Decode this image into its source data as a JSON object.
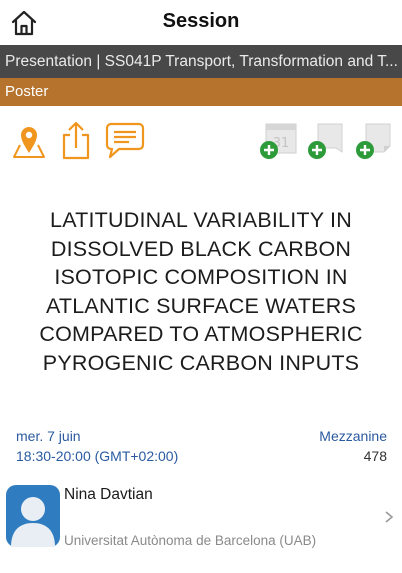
{
  "header": {
    "title": "Session"
  },
  "presentation_bar": {
    "text": "Presentation | SS041P Transport, Transformation and T..."
  },
  "poster_bar": {
    "label": "Poster"
  },
  "toolbar": {
    "left": [
      "map-pin-icon",
      "share-icon",
      "comment-icon"
    ],
    "right": [
      "add-calendar-icon",
      "add-bookmark-icon",
      "add-note-icon"
    ]
  },
  "session": {
    "title": "LATITUDINAL VARIABILITY IN DISSOLVED BLACK CARBON ISOTOPIC COMPOSITION IN ATLANTIC SURFACE WATERS COMPARED TO ATMOSPHERIC PYROGENIC CARBON INPUTS",
    "date": "mer. 7 juin",
    "time": "18:30-20:00 (GMT+02:00)",
    "room": "Mezzanine",
    "room_number": "478"
  },
  "speaker": {
    "name": "Nina Davtian",
    "affiliation": "Universitat Autònoma de Barcelona (UAB)"
  },
  "colors": {
    "accent": "#f0961e",
    "link": "#2a5aa0",
    "presentation_bar": "#484848",
    "poster_bar": "#b5732e",
    "add_green": "#2e9b3a"
  }
}
